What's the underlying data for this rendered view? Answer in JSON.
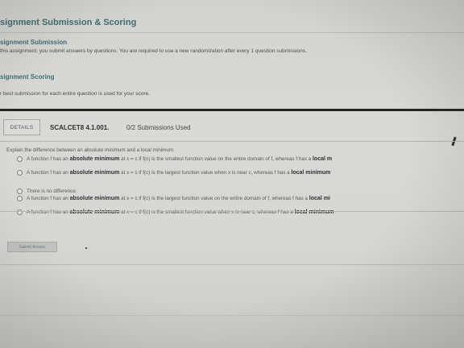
{
  "header": {
    "title": "signment Submission & Scoring"
  },
  "assignment_submission": {
    "label": "signment Submission",
    "text": "this assignment, you submit answers by questions. You are required to use a new randomization after every 1 question submissions."
  },
  "assignment_scoring": {
    "label": "signment Scoring",
    "text": "r best submission for each entire question is used for your score."
  },
  "question": {
    "details_label": "DETAILS",
    "code": "SCALCET8 4.1.001.",
    "submissions": "0/2 Submissions Used",
    "prompt": "Explain the difference between an absolute minimum and a local minimum.",
    "options": [
      {
        "pre": "A function f has an",
        "bold": "absolute minimum",
        "mid": "at x = c if f(c) is the smallest function value on the entire domain of f, whereas f has a",
        "bold2": "local m"
      },
      {
        "pre": "A function f has an",
        "bold": "absolute minimum",
        "mid": "at x = c if f(c) is the largest function value when x is near c, whereas f has a",
        "bold2": "local minimum"
      },
      {
        "pre": "There is no difference.",
        "bold": "",
        "mid": "",
        "bold2": ""
      },
      {
        "pre": "A function f has an",
        "bold": "absolute minimum",
        "mid": "at x = c if f(c) is the largest function value on the entire domain of f, whereas f has a",
        "bold2": "local mi"
      },
      {
        "pre": "A function f has an",
        "bold": "absolute minimum",
        "mid": "at x = c if f(c) is the smallest function value when x is near c, whereas f has a",
        "bold2": "local minimum"
      }
    ],
    "submit_label": "Submit Answer"
  },
  "icons": {
    "edit": "pencil-icon"
  }
}
